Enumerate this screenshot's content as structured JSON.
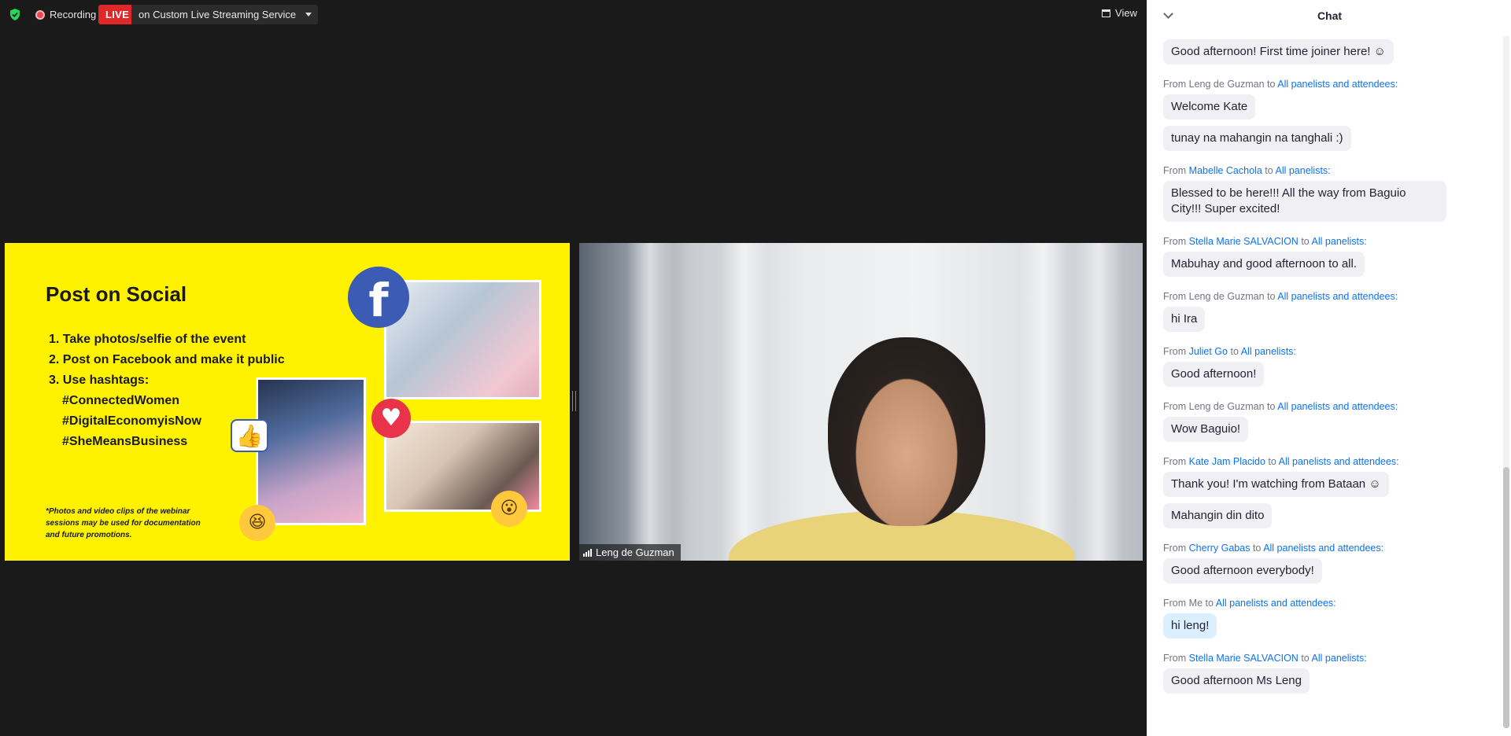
{
  "topbar": {
    "recording_label": "Recording",
    "live_label": "LIVE",
    "live_service": "on Custom Live Streaming Service",
    "view_label": "View"
  },
  "slide": {
    "title": "Post on Social",
    "items": [
      "1. Take photos/selfie of the event",
      "2. Post on Facebook and make it public",
      "3. Use hashtags:"
    ],
    "hashtags": [
      "#ConnectedWomen",
      "#DigitalEconomyisNow",
      "#SheMeansBusiness"
    ],
    "note": "*Photos and video clips of the webinar sessions may be used for documentation and future promotions.",
    "fb_glyph": "f",
    "heart_glyph": "♥",
    "thumb_glyph": "👍",
    "emoji_laugh": "😆",
    "emoji_wow": "😮"
  },
  "video": {
    "participant_name": "Leng de Guzman"
  },
  "chat": {
    "title": "Chat",
    "from_word": "From",
    "to_word": "to",
    "messages": [
      {
        "text": "Good afternoon! First time joiner here! ☺"
      },
      {
        "from": "Leng de Guzman",
        "from_link": false,
        "to": "All panelists and attendees:",
        "text": "Welcome Kate"
      },
      {
        "text": "tunay na mahangin na tanghali :)"
      },
      {
        "from": "Mabelle Cachola",
        "from_link": true,
        "to": "All panelists:",
        "text": "Blessed to be here!!! All the way from Baguio City!!! Super excited!"
      },
      {
        "from": "Stella Marie SALVACION",
        "from_link": true,
        "to": "All panelists:",
        "text": "Mabuhay and good afternoon to all."
      },
      {
        "from": "Leng de Guzman",
        "from_link": false,
        "to": "All panelists and attendees:",
        "text": "hi Ira"
      },
      {
        "from": "Juliet Go",
        "from_link": true,
        "to": "All panelists:",
        "text": "Good afternoon!"
      },
      {
        "from": "Leng de Guzman",
        "from_link": false,
        "to": "All panelists and attendees:",
        "text": "Wow Baguio!"
      },
      {
        "from": "Kate Jam Placido",
        "from_link": true,
        "to": "All panelists and attendees:",
        "text": "Thank you! I'm watching from Bataan ☺"
      },
      {
        "text": "Mahangin din dito"
      },
      {
        "from": "Cherry Gabas",
        "from_link": true,
        "to": "All panelists and attendees:",
        "text": "Good afternoon everybody!"
      },
      {
        "from": "Me",
        "from_link": false,
        "to": "All panelists and attendees:",
        "text": "hi leng!",
        "mine": true
      },
      {
        "from": "Stella Marie SALVACION",
        "from_link": true,
        "to": "All panelists:",
        "text": "Good afternoon Ms Leng"
      }
    ]
  },
  "colors": {
    "live_red": "#e02828",
    "slide_yellow": "#fff200",
    "link_blue": "#0e72ed",
    "bubble_gray": "#f0f0f4",
    "bubble_mine": "#dcefff"
  }
}
